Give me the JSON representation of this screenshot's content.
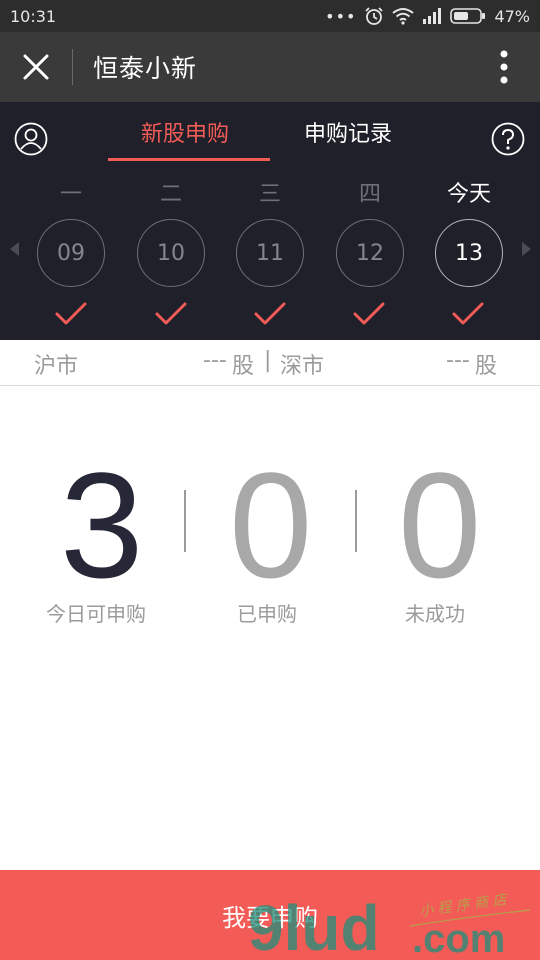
{
  "status_bar": {
    "time": "10:31",
    "battery": "47%"
  },
  "header": {
    "title": "恒泰小新"
  },
  "tabs": [
    {
      "label": "新股申购",
      "active": true
    },
    {
      "label": "申购记录",
      "active": false
    }
  ],
  "calendar": {
    "days": [
      {
        "weekday": "一",
        "date": "09",
        "checked": true
      },
      {
        "weekday": "二",
        "date": "10",
        "checked": true
      },
      {
        "weekday": "三",
        "date": "11",
        "checked": true
      },
      {
        "weekday": "四",
        "date": "12",
        "checked": true
      },
      {
        "weekday": "今天",
        "date": "13",
        "checked": true,
        "today": true
      }
    ]
  },
  "markets": {
    "sh_label": "沪市",
    "sh_value": "---",
    "sh_unit": "股",
    "separator": "|",
    "sz_label": "深市",
    "sz_value": "---",
    "sz_unit": "股"
  },
  "stats": [
    {
      "value": "3",
      "label": "今日可申购"
    },
    {
      "value": "0",
      "label": "已申购"
    },
    {
      "value": "0",
      "label": "未成功"
    }
  ],
  "action": {
    "label": "我要申购"
  },
  "watermark": {
    "text": "小程序商店",
    "logo": "9lud.com"
  },
  "colors": {
    "accent": "#f25b56",
    "dark_bg": "#1f2029",
    "today_number": "#262838",
    "muted_number": "#a8a8a8"
  }
}
